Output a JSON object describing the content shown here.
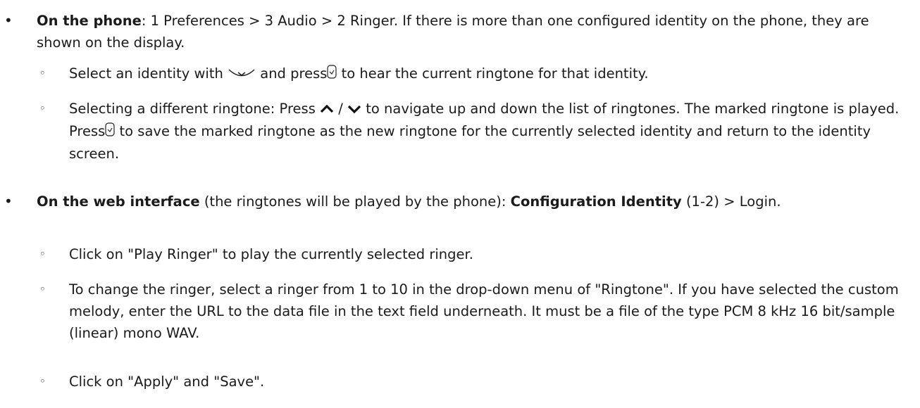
{
  "bullets": {
    "main": "•",
    "sub": "◦"
  },
  "phone": {
    "label": "On the phone",
    "path": ":  1 Preferences > 3 Audio > 2 Ringer.  If there is more than one configured identity on the phone, they are shown on the display.",
    "sub1": {
      "a": "Select an identity with",
      "b": "and press",
      "c": "to hear the current ringtone for that identity."
    },
    "sub2": {
      "a": "Selecting a different ringtone:  Press",
      "slash": "/",
      "b": "to navigate up and down the list of ringtones.  The marked ringtone is played.  Press",
      "c": "to save the marked ringtone as the new ringtone for the currently selected identity and return to the identity screen."
    }
  },
  "web": {
    "label": "On the web interface",
    "middle": " (the ringtones will be played by the phone):  ",
    "config": "Configuration Identity",
    "tail": " (1-2) > Login.",
    "sub1": "Click on \"Play Ringer\" to play the currently selected ringer.",
    "sub2": "To change the ringer, select a ringer from 1 to 10 in the drop-down menu of \"Ringtone\".  If you have selected the custom melody, enter the URL to the data file in the text field underneath.  It must be a file of the type PCM 8 kHz 16 bit/sample (linear) mono WAV.",
    "sub3": "Click on \"Apply\" and \"Save\"."
  },
  "icons": {
    "navigation_key": "nav-down-key-icon",
    "ok_key": "ok-key-icon",
    "up": "up-arrow-icon",
    "down": "down-arrow-icon"
  }
}
